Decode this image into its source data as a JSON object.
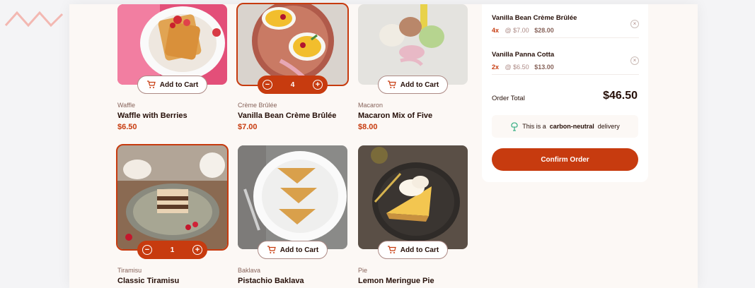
{
  "products": [
    {
      "category": "Waffle",
      "name": "Waffle with Berries",
      "price": "$6.50",
      "cta": "Add to Cart"
    },
    {
      "category": "Crème Brûlée",
      "name": "Vanilla Bean Crème Brûlée",
      "price": "$7.00",
      "quantity": "4"
    },
    {
      "category": "Macaron",
      "name": "Macaron Mix of Five",
      "price": "$8.00",
      "cta": "Add to Cart"
    },
    {
      "category": "Tiramisu",
      "name": "Classic Tiramisu",
      "quantity": "1"
    },
    {
      "category": "Baklava",
      "name": "Pistachio Baklava",
      "cta": "Add to Cart"
    },
    {
      "category": "Pie",
      "name": "Lemon Meringue Pie",
      "cta": "Add to Cart"
    }
  ],
  "cart": {
    "items": [
      {
        "name": "Vanilla Bean Crème Brûlée",
        "qty": "4x",
        "unit": "@ $7.00",
        "total": "$28.00"
      },
      {
        "name": "Vanilla Panna Cotta",
        "qty": "2x",
        "unit": "@ $6.50",
        "total": "$13.00"
      }
    ],
    "order_total_label": "Order Total",
    "order_total_value": "$46.50",
    "carbon_prefix": "This is a",
    "carbon_bold": "carbon-neutral",
    "carbon_suffix": "delivery",
    "confirm_label": "Confirm Order"
  },
  "colors": {
    "accent": "#c73b0f",
    "background": "#fcf8f5",
    "text_dark": "#260f08"
  },
  "icons": {
    "cart": "cart-icon",
    "minus": "minus-icon",
    "plus": "plus-icon",
    "remove": "remove-icon",
    "tree": "tree-icon"
  }
}
